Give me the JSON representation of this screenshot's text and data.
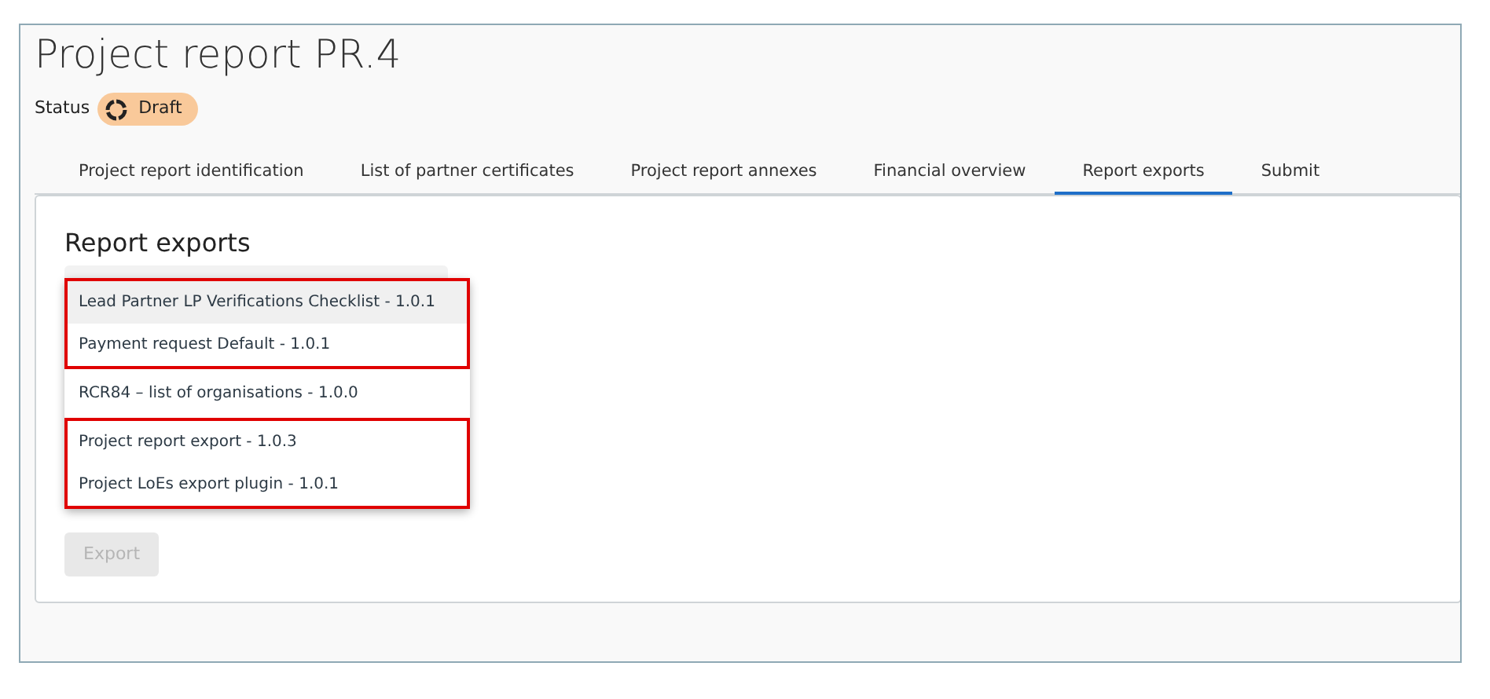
{
  "page": {
    "title": "Project report PR.4"
  },
  "status": {
    "label": "Status",
    "value": "Draft"
  },
  "tabs": [
    {
      "label": "Project report identification",
      "selected": false
    },
    {
      "label": "List of partner certificates",
      "selected": false
    },
    {
      "label": "Project report annexes",
      "selected": false
    },
    {
      "label": "Financial overview",
      "selected": false
    },
    {
      "label": "Report exports",
      "selected": true
    },
    {
      "label": "Submit",
      "selected": false
    }
  ],
  "section": {
    "title": "Report exports",
    "dropdown": {
      "option_groups": [
        {
          "highlighted": true,
          "options": [
            {
              "label": "Lead Partner LP Verifications Checklist - 1.0.1",
              "selected": true
            },
            {
              "label": "Payment request Default - 1.0.1",
              "selected": false
            }
          ]
        },
        {
          "highlighted": false,
          "options": [
            {
              "label": "RCR84 – list of organisations - 1.0.0",
              "selected": false
            }
          ]
        },
        {
          "highlighted": true,
          "options": [
            {
              "label": "Project report export - 1.0.3",
              "selected": false
            },
            {
              "label": "Project LoEs export plugin - 1.0.1",
              "selected": false
            }
          ]
        }
      ]
    },
    "export_button": {
      "label": "Export",
      "disabled": true
    }
  }
}
